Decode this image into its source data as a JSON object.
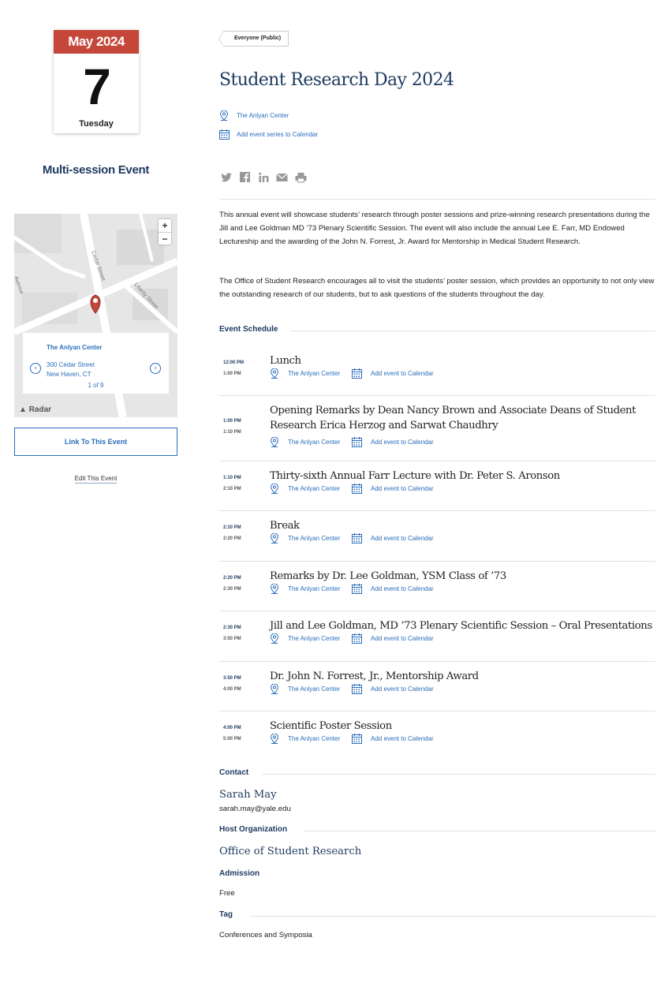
{
  "date": {
    "month_year": "May 2024",
    "day": "7",
    "weekday": "Tuesday"
  },
  "event_type": "Multi-session Event",
  "map": {
    "zoom_in": "+",
    "zoom_out": "−",
    "streets": [
      "Cedar Street",
      "Liberty Street",
      "Avenue"
    ],
    "popup": {
      "name": "The Anlyan Center",
      "address_line1": "300 Cedar Street",
      "address_line2": "New Haven, CT",
      "count": "1 of 9",
      "prev": "‹",
      "next": "›"
    },
    "attribution": "Radar"
  },
  "actions": {
    "link_button": "Link To This Event",
    "edit_link": "Edit This Event"
  },
  "event": {
    "audience": "Everyone (Public)",
    "title": "Student Research Day 2024",
    "location": "The Anlyan Center",
    "add_series": "Add event series to Calendar",
    "share_icons": [
      "twitter-icon",
      "facebook-icon",
      "linkedin-icon",
      "email-icon",
      "print-icon"
    ],
    "description": [
      "This annual event will showcase students’ research through poster sessions and prize-winning research presentations during the Jill and Lee Goldman MD ’73 Plenary Scientific Session. The event will also include the annual Lee E. Farr, MD Endowed Lectureship and the awarding of the John N. Forrest, Jr. Award for Mentorship in Medical Student Research.",
      "The Office of Student Research encourages all to visit the students’ poster session, which provides an opportunity to not only view the outstanding research of our students, but to ask questions of the students throughout the day."
    ]
  },
  "schedule": {
    "heading": "Event Schedule",
    "sessions": [
      {
        "start": "12:00 PM",
        "end": "1:00 PM",
        "title": "Lunch",
        "location": "The Anlyan Center",
        "add": "Add event to Calendar"
      },
      {
        "start": "1:00 PM",
        "end": "1:10 PM",
        "title": "Opening Remarks by Dean Nancy Brown and Associate Deans of Student Research Erica Herzog and Sarwat Chaudhry",
        "location": "The Anlyan Center",
        "add": "Add event to Calendar"
      },
      {
        "start": "1:10 PM",
        "end": "2:10 PM",
        "title": "Thirty-sixth Annual Farr Lecture with Dr. Peter S. Aronson",
        "location": "The Anlyan Center",
        "add": "Add event to Calendar"
      },
      {
        "start": "2:10 PM",
        "end": "2:20 PM",
        "title": "Break",
        "location": "The Anlyan Center",
        "add": "Add event to Calendar"
      },
      {
        "start": "2:20 PM",
        "end": "2:30 PM",
        "title": "Remarks by Dr. Lee Goldman, YSM Class of ’73",
        "location": "The Anlyan Center",
        "add": "Add event to Calendar"
      },
      {
        "start": "2:30 PM",
        "end": "3:50 PM",
        "title": "Jill and Lee Goldman, MD ’73 Plenary Scientific Session – Oral Presentations",
        "location": "The Anlyan Center",
        "add": "Add event to Calendar"
      },
      {
        "start": "3:50 PM",
        "end": "4:00 PM",
        "title": "Dr. John N. Forrest, Jr., Mentorship Award",
        "location": "The Anlyan Center",
        "add": "Add event to Calendar"
      },
      {
        "start": "4:00 PM",
        "end": "5:00 PM",
        "title": "Scientific Poster Session",
        "location": "The Anlyan Center",
        "add": "Add event to Calendar"
      }
    ]
  },
  "contact": {
    "heading": "Contact",
    "name": "Sarah May",
    "email": "sarah.may@yale.edu"
  },
  "host": {
    "heading": "Host Organization",
    "name": "Office of Student Research"
  },
  "admission": {
    "heading": "Admission",
    "value": "Free"
  },
  "tag": {
    "heading": "Tag",
    "value": "Conferences and Symposia"
  },
  "colors": {
    "navy": "#1e3a5f",
    "link": "#2a6ebb",
    "calendar_red": "#c4473a"
  }
}
